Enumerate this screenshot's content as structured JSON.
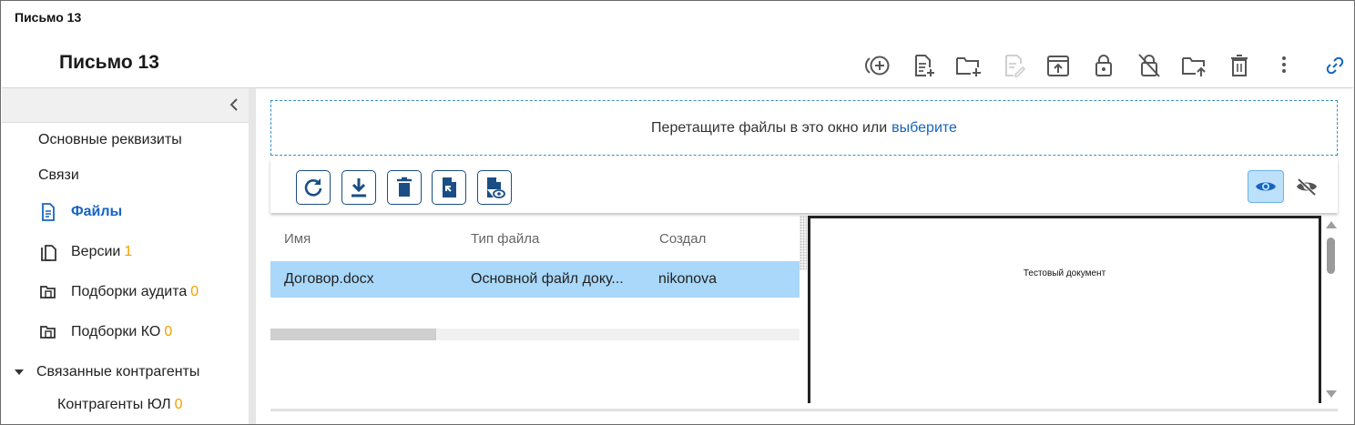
{
  "window": {
    "title": "Письмо 13"
  },
  "header": {
    "title": "Письмо 13",
    "toolbar": [
      {
        "icon": "add-circle-icon"
      },
      {
        "icon": "file-add-icon"
      },
      {
        "icon": "folder-add-icon"
      },
      {
        "icon": "edit-file-icon",
        "disabled": true
      },
      {
        "icon": "upload-icon"
      },
      {
        "icon": "lock-icon"
      },
      {
        "icon": "unlock-icon"
      },
      {
        "icon": "folder-upload-icon"
      },
      {
        "icon": "delete-icon"
      },
      {
        "icon": "more-vert-icon"
      }
    ],
    "link_icon": "link-icon",
    "accent": "#1565c0"
  },
  "sidebar": {
    "items": [
      {
        "label": "Основные реквизиты"
      },
      {
        "label": "Связи"
      },
      {
        "label": "Файлы",
        "icon": "file-icon",
        "active": true
      },
      {
        "label": "Версии",
        "icon": "copy-icon",
        "count": "1"
      },
      {
        "label": "Подборки аудита",
        "icon": "folder-copy-icon",
        "count": "0"
      },
      {
        "label": "Подборки КО",
        "icon": "folder-copy-icon",
        "count": "0"
      },
      {
        "label": "Связанные контрагенты",
        "icon": "caret-down-icon",
        "expanded": true
      },
      {
        "label": "Контрагенты ЮЛ",
        "count": "0"
      }
    ]
  },
  "dropzone": {
    "text": "Перетащите файлы в это окно или",
    "link": "выберите"
  },
  "files_toolbar": {
    "buttons": [
      "refresh-icon",
      "download-icon",
      "delete-icon",
      "file-import-icon",
      "file-preview-icon"
    ],
    "toggles": [
      "eye-icon",
      "eye-off-icon"
    ]
  },
  "table": {
    "columns": [
      "Имя",
      "Тип файла",
      "Создал"
    ],
    "rows": [
      {
        "name": "Договор.docx",
        "type": "Основной файл доку...",
        "author": "nikonova"
      }
    ]
  },
  "preview": {
    "text": "Тестовый документ"
  }
}
